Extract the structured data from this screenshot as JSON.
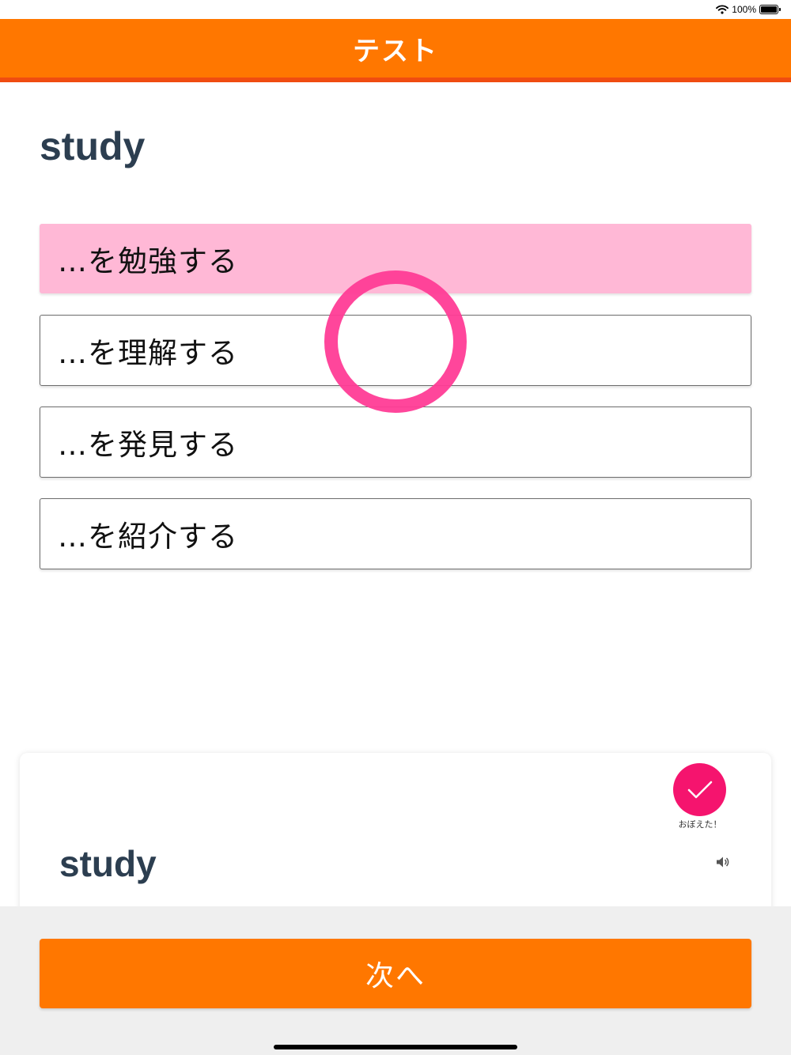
{
  "status_bar": {
    "battery_text": "100%",
    "battery_level": 1.0
  },
  "header": {
    "title": "テスト"
  },
  "question": {
    "word": "study"
  },
  "choices": [
    {
      "label": "…を勉強する",
      "state": "correct"
    },
    {
      "label": "…を理解する",
      "state": "normal"
    },
    {
      "label": "…を発見する",
      "state": "normal"
    },
    {
      "label": "…を紹介する",
      "state": "normal"
    }
  ],
  "card": {
    "word": "study",
    "memorized_label": "おぼえた！"
  },
  "footer": {
    "next_label": "次へ"
  },
  "colors": {
    "accent": "#ff7700",
    "correct_fill": "#ffb8d6",
    "correct_mark": "#ff3c96",
    "memorized": "#f5146e",
    "word_text": "#2c3e50"
  },
  "icons": {
    "wifi": "wifi-icon",
    "battery": "battery-icon",
    "check": "check-icon",
    "speaker": "speaker-icon",
    "correct_mark": "correct-circle-icon"
  }
}
